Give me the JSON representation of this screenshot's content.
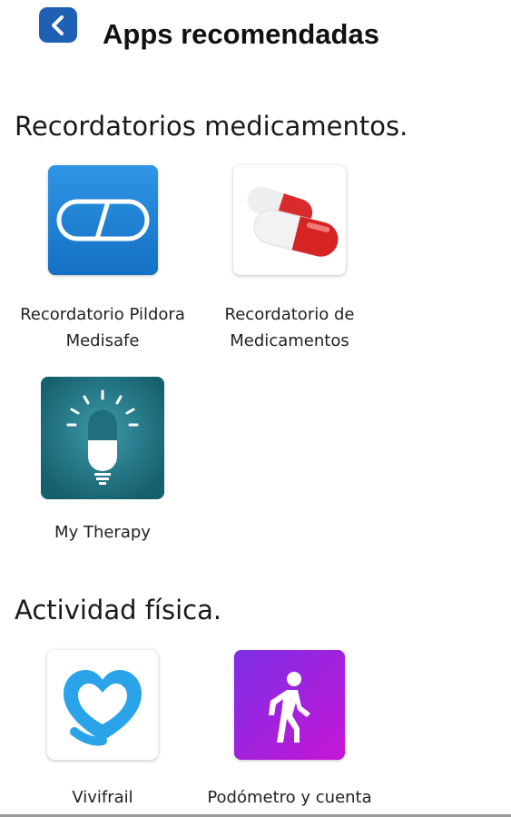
{
  "header": {
    "title": "Apps recomendadas",
    "back_icon": "chevron-left-icon",
    "accent": "#1f5fb4"
  },
  "sections": [
    {
      "title": "Recordatorios medicamentos.",
      "apps": [
        {
          "label": "Recordatorio Pildora\nMedisafe",
          "icon": "medisafe-pill-icon",
          "color": "#1e7fd0"
        },
        {
          "label": "Recordatorio de\nMedicamentos",
          "icon": "red-capsule-icon",
          "color": "#d92b2b"
        },
        {
          "label": "My Therapy",
          "icon": "lightbulb-pill-icon",
          "color": "#1f6f7e"
        }
      ]
    },
    {
      "title": "Actividad física.",
      "apps": [
        {
          "label": "Vivifrail",
          "icon": "blue-heart-icon",
          "color": "#2aa3e8"
        },
        {
          "label": "Podómetro y cuenta",
          "icon": "walking-person-icon",
          "color": "#8a2be2"
        }
      ]
    }
  ]
}
